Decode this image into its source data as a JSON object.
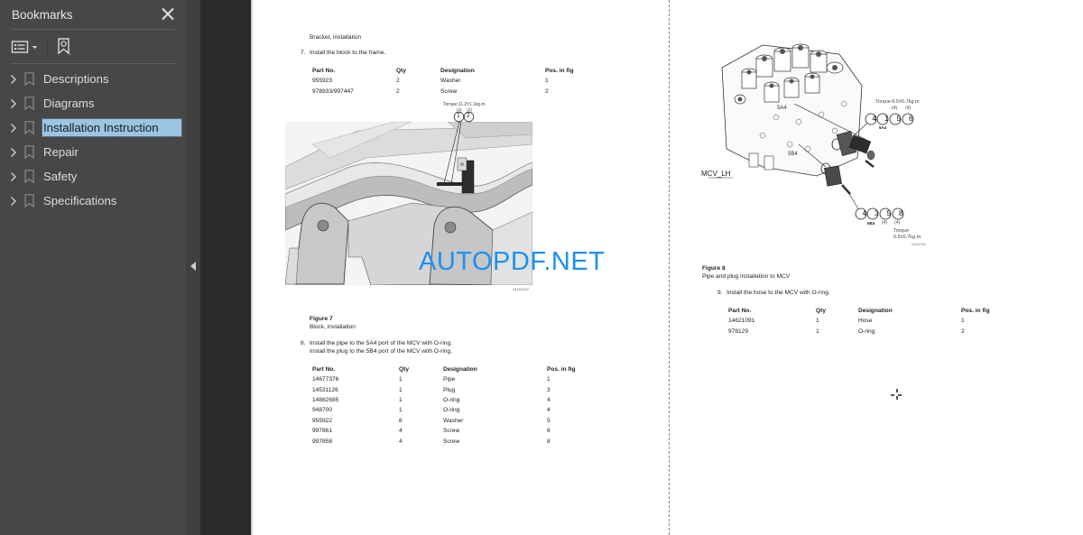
{
  "sidebar": {
    "title": "Bookmarks",
    "close_icon": "close-icon",
    "toolbar": {
      "options_icon": "list-options-icon",
      "find_bookmark_icon": "find-bookmark-icon"
    },
    "items": [
      {
        "label": "Descriptions",
        "selected": false
      },
      {
        "label": "Diagrams",
        "selected": false
      },
      {
        "label": "Installation Instruction",
        "selected": true
      },
      {
        "label": "Repair",
        "selected": false
      },
      {
        "label": "Safety",
        "selected": false
      },
      {
        "label": "Specifications",
        "selected": false
      }
    ]
  },
  "splitter": {
    "collapse_icon": "collapse-left-icon"
  },
  "left_page": {
    "caption_top": "Bracket, installation",
    "step7": {
      "number": "7.",
      "text": "Install the block to the frame.",
      "headers": [
        "Part No.",
        "Qty",
        "Designation",
        "Pos. in fig"
      ],
      "rows": [
        [
          "955923",
          "2",
          "Washer",
          "1"
        ],
        [
          "978933/997447",
          "2",
          "Screw",
          "2"
        ]
      ]
    },
    "figure7": {
      "torque_label": "Torque:11.2±1.1kg.m",
      "callout_sub": [
        "(2)",
        "(2)"
      ],
      "callouts": [
        "1",
        "2"
      ],
      "image_id": "V1157447",
      "title": "Figure 7",
      "caption": "Block, installation"
    },
    "step8": {
      "number": "8.",
      "text_line1": "Install the pipe to the 5A4 port of the MCV with O-ring.",
      "text_line2": "Install the plug to the 5B4 port of the MCV with O-ring.",
      "headers": [
        "Part No.",
        "Qty",
        "Designation",
        "Pos. in fig"
      ],
      "rows": [
        [
          "14677376",
          "1",
          "Pipe",
          "1"
        ],
        [
          "14531126",
          "1",
          "Plug",
          "3"
        ],
        [
          "14882685",
          "1",
          "O-ring",
          "4"
        ],
        [
          "948700",
          "1",
          "O-ring",
          "4"
        ],
        [
          "955922",
          "8",
          "Washer",
          "5"
        ],
        [
          "997861",
          "4",
          "Screw",
          "6"
        ],
        [
          "997858",
          "4",
          "Screw",
          "8"
        ]
      ]
    }
  },
  "watermark": "AUTOPDF.NET",
  "right_page": {
    "figure8": {
      "label_mcv": "MCV_LH",
      "port_5a4": "5A4",
      "port_5b4": "5B4",
      "torque_top": "Torque:6.5±0.7kg.m",
      "top_sub": [
        "(4)",
        "(4)"
      ],
      "top_callouts": [
        "4",
        "1",
        "5",
        "6"
      ],
      "top_port": "5A4",
      "bottom_callouts": [
        "4",
        "3",
        "5",
        "8"
      ],
      "bottom_port": "5B4",
      "bottom_sub": [
        "(4)",
        "(4)"
      ],
      "torque_bottom_1": "Torque:",
      "torque_bottom_2": "6.5±0.7kg.m",
      "image_id": "V1157315",
      "title": "Figure 8",
      "caption": "Pipe and plug installation to MCV"
    },
    "step9": {
      "number": "9.",
      "text": "Install the hose to the MCV with O-ring.",
      "headers": [
        "Part No.",
        "Qty",
        "Designation",
        "Pos. in fig"
      ],
      "rows": [
        [
          "14621091",
          "1",
          "Hose",
          "1"
        ],
        [
          "978129",
          "1",
          "O-ring",
          "2"
        ]
      ]
    }
  },
  "cursor": {
    "icon": "crosshair-cursor-icon"
  }
}
